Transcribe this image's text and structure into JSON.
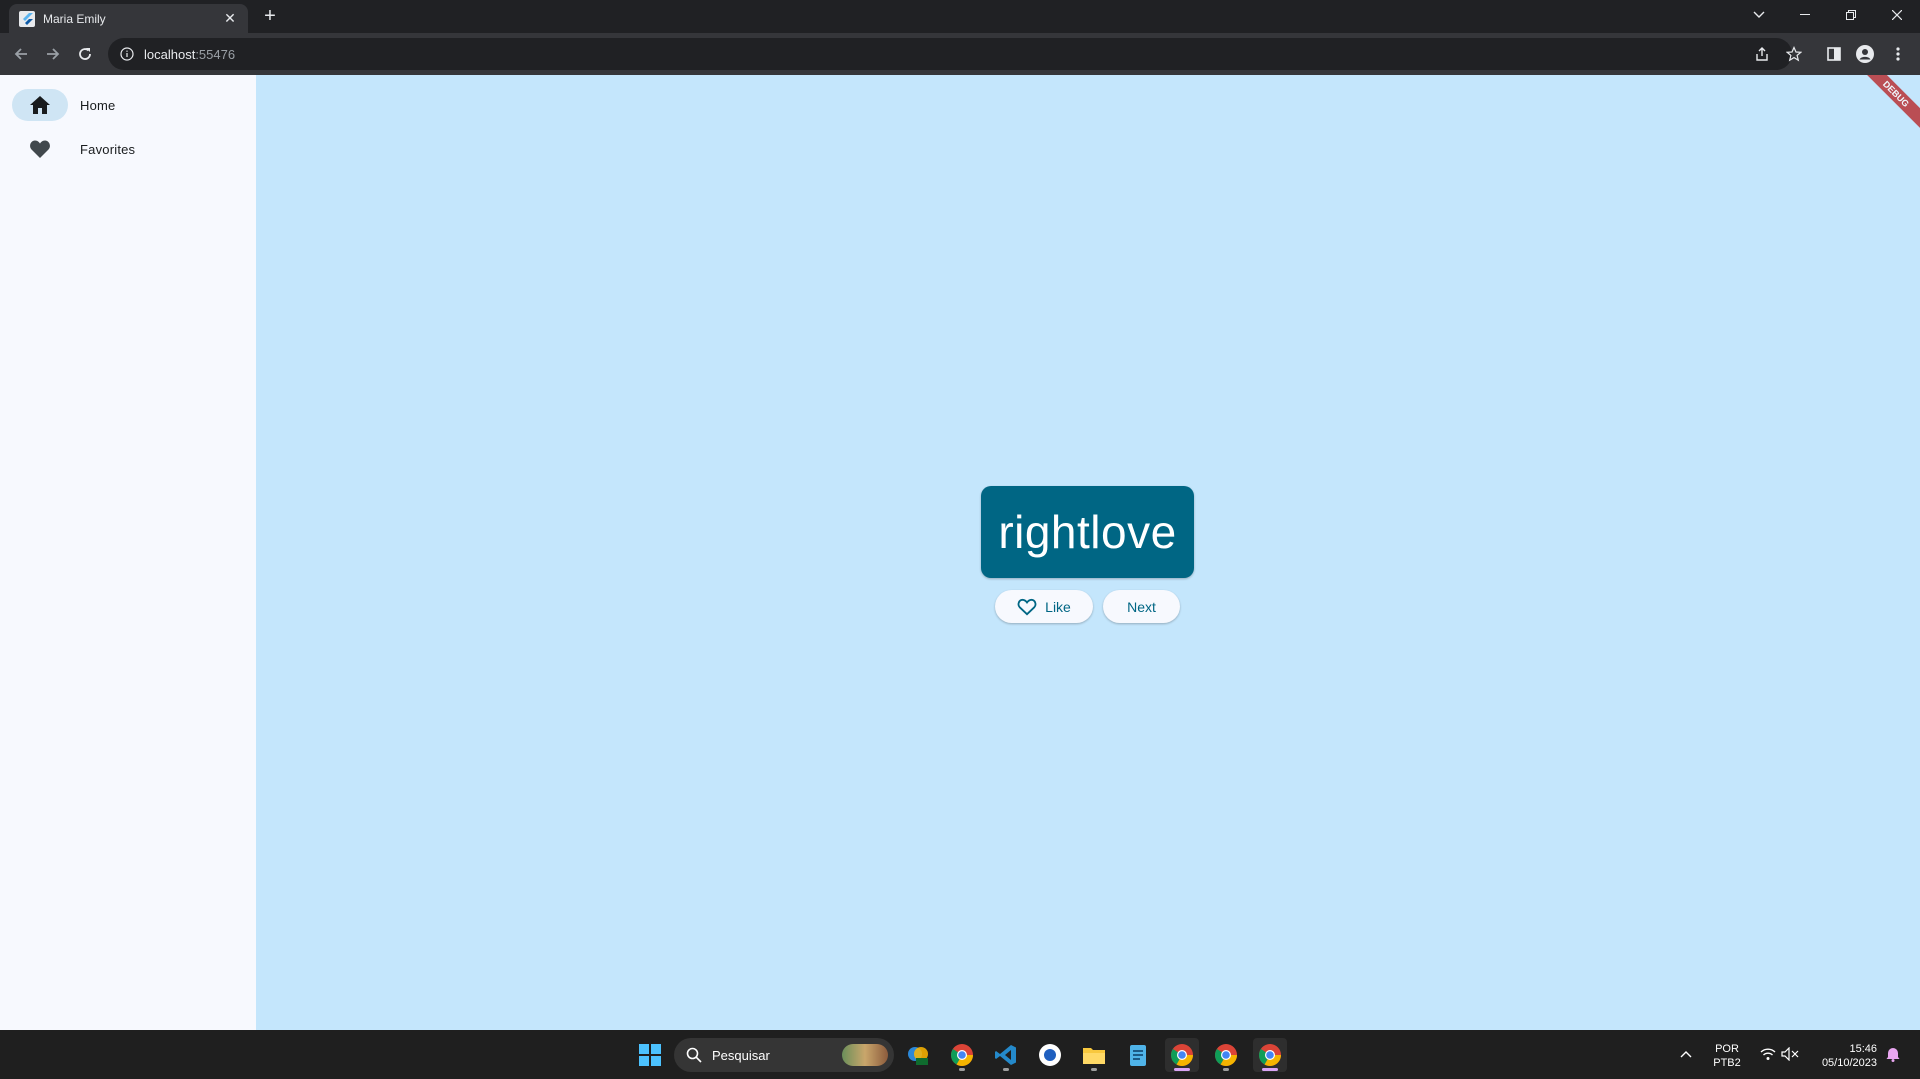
{
  "browser": {
    "tab_title": "Maria Emily",
    "url_host": "localhost",
    "url_port": ":55476"
  },
  "nav": {
    "items": [
      {
        "label": "Home",
        "icon": "home-icon",
        "selected": true
      },
      {
        "label": "Favorites",
        "icon": "heart-icon",
        "selected": false
      }
    ]
  },
  "main": {
    "word": "rightlove",
    "like_label": "Like",
    "next_label": "Next",
    "debug_label": "DEBUG"
  },
  "taskbar": {
    "search_placeholder": "Pesquisar",
    "lang_line1": "POR",
    "lang_line2": "PTB2",
    "time": "15:46",
    "date": "05/10/2023"
  },
  "colors": {
    "page_background": "#c4e6fc",
    "card": "#006684",
    "rail_background": "#f7f9fe",
    "selected_indicator": "#cfe5f4"
  }
}
